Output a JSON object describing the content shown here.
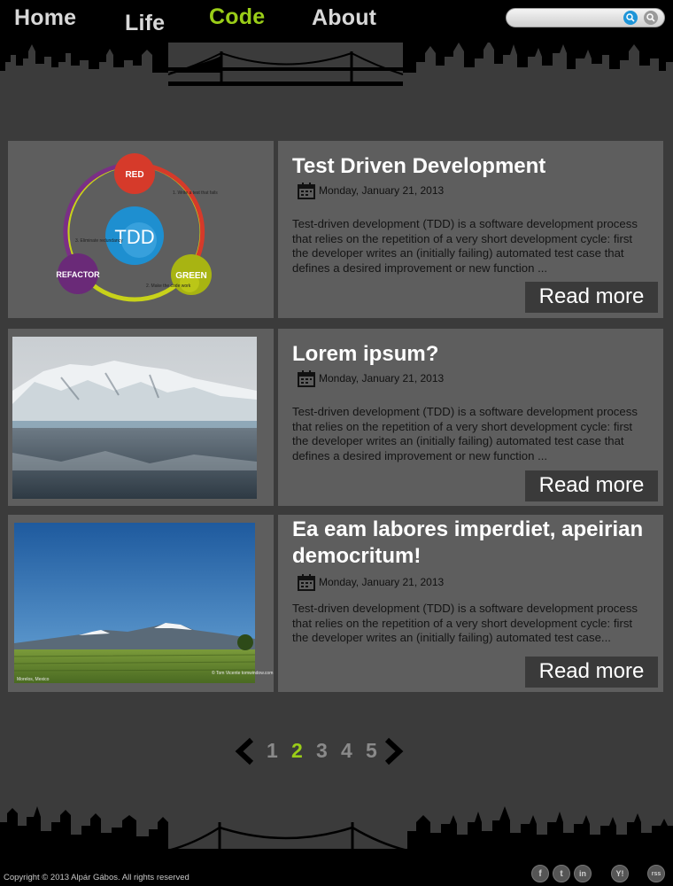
{
  "nav": {
    "items": [
      {
        "label": "Home"
      },
      {
        "label": "Life"
      },
      {
        "label": "Code"
      },
      {
        "label": "About"
      }
    ],
    "active": "Code"
  },
  "search": {
    "placeholder": "",
    "value": ""
  },
  "posts": [
    {
      "title": "Test Driven Development",
      "date": "Monday, January 21, 2013",
      "excerpt": "Test-driven development (TDD) is a software development process that relies on the repetition of a very short development cycle: first the developer writes an (initially failing) automated test case that defines a desired improvement or new function ...",
      "read_more": "Read more",
      "diagram": {
        "center": "TDD",
        "red": "RED",
        "green": "GREEN",
        "refactor": "REFACTOR",
        "step1": "1. Write a test that fails",
        "step2": "2. Make the code work",
        "step3": "3. Eliminate redundancy"
      }
    },
    {
      "title": "Lorem ipsum?",
      "date": "Monday, January 21, 2013",
      "excerpt": "Test-driven development (TDD) is a software development process that relies on the repetition of a very short development cycle: first the developer writes an (initially failing) automated test case that defines a desired improvement or new function ...",
      "read_more": "Read more"
    },
    {
      "title": "Ea eam labores imperdiet, apeirian democritum!",
      "date": "Monday, January 21, 2013",
      "excerpt": "Test-driven development (TDD) is a software development process that relies on the repetition of a very short development cycle: first the developer writes an (initially failing) automated test case...",
      "read_more": "Read more",
      "photo_caption_left": "Morelos, Mexico",
      "photo_caption_right": "© Tom Vicente tomwindow.com"
    }
  ],
  "pagination": {
    "pages": [
      "1",
      "2",
      "3",
      "4",
      "5"
    ],
    "current": "2"
  },
  "footer": {
    "copyright": "Copyright © 2013 Alpár Gábos. All rights reserved",
    "social": [
      {
        "icon": "facebook-icon",
        "glyph": "f"
      },
      {
        "icon": "twitter-icon",
        "glyph": "t"
      },
      {
        "icon": "linkedin-icon",
        "glyph": "in"
      },
      {
        "icon": "yahoo-icon",
        "glyph": "Y!"
      },
      {
        "icon": "rss-icon",
        "glyph": "rss"
      }
    ]
  },
  "colors": {
    "accent": "#9acd18",
    "panel": "#5e5e5e",
    "background": "#3b3b3b",
    "button": "#3a3a3a"
  }
}
